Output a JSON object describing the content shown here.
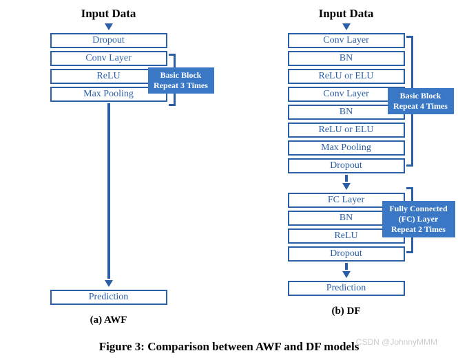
{
  "input_label": "Input Data",
  "prediction_label": "Prediction",
  "awf": {
    "caption": "(a) AWF",
    "layers": [
      "Dropout",
      "Conv Layer",
      "ReLU",
      "Max Pooling"
    ],
    "annot": "Basic Block\nRepeat 3 Times"
  },
  "df": {
    "caption": "(b) DF",
    "block1": [
      "Conv Layer",
      "BN",
      "ReLU or ELU",
      "Conv Layer",
      "BN",
      "ReLU or ELU",
      "Max Pooling",
      "Dropout"
    ],
    "block2": [
      "FC Layer",
      "BN",
      "ReLU",
      "Dropout"
    ],
    "annot1": "Basic Block\nRepeat 4 Times",
    "annot2": "Fully Connected\n(FC)  Layer\nRepeat 2 Times"
  },
  "figure_caption": "Figure 3: Comparison between AWF and DF models",
  "watermark": "CSDN @JohnnyMMM"
}
